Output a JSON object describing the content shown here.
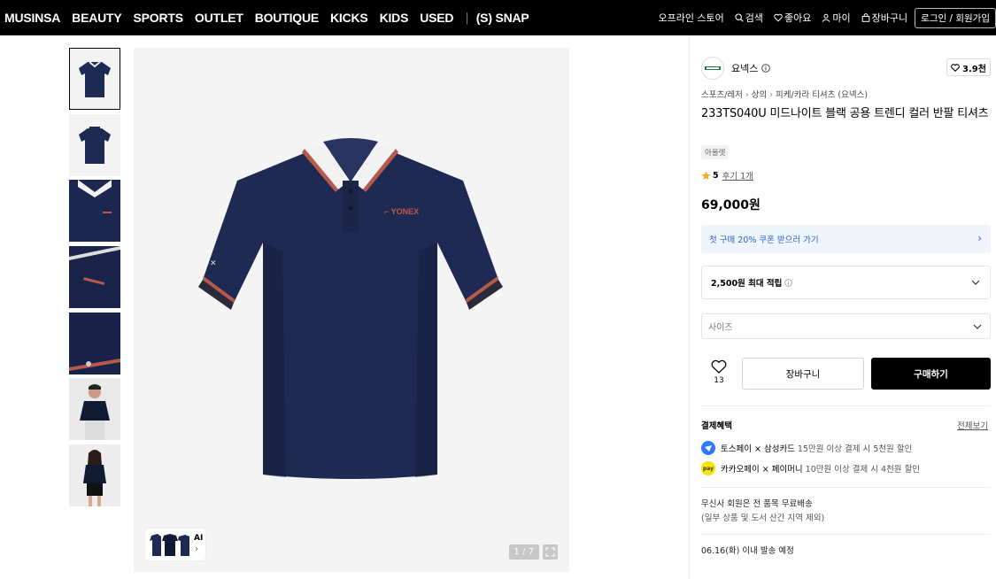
{
  "nav": {
    "items": [
      "MUSINSA",
      "BEAUTY",
      "SPORTS",
      "OUTLET",
      "BOUTIQUE",
      "KICKS",
      "KIDS",
      "USED"
    ],
    "snap": "(S) SNAP",
    "offline_store": "오프라인 스토어",
    "search": "검색",
    "likes": "좋아요",
    "my": "마이",
    "cart": "장바구니",
    "login": "로그인 / 회원가입"
  },
  "gallery": {
    "ai_label": "AI",
    "counter": "1 / 7"
  },
  "product": {
    "brand_name": "요넥스",
    "brand_likes": "3.9천",
    "breadcrumbs": [
      "스포츠/레저",
      "상의",
      "피케/카라 티셔츠 (요넥스)"
    ],
    "title": "233TS040U 미드나이트 블랙 공용 트렌디 컬러 반팔 티셔츠",
    "tag": "아울렛",
    "rating": "5",
    "reviews": "후기 1개",
    "price": "69,000원",
    "coupon": "첫 구매 20% 쿠폰 받으러 가기",
    "points": "2,500원 최대 적립",
    "size_placeholder": "사이즈",
    "like_count": "13",
    "cart_button": "장바구니",
    "buy_button": "구매하기"
  },
  "benefits": {
    "title": "결제혜택",
    "view_all": "전체보기",
    "rows": [
      {
        "name": "토스페이 × 삼성카드",
        "desc": "15만원 이상 결제 시 5천원 할인",
        "icon": "toss-icon",
        "color": "#2f7bf5"
      },
      {
        "name": "카카오페이 × 페이머니",
        "desc": "10만원 이상 결제 시 4천원 할인",
        "icon": "kakaopay-icon",
        "color": "#ffe300"
      }
    ]
  },
  "shipping": {
    "line1": "무신사 회원은 전 품목 무료배송",
    "line2": "(일부 상품 및 도서 산간 지역 제외)",
    "line3": "06.16(화) 이내 발송 예정"
  },
  "colors": {
    "shirt_navy": "#1e2a52",
    "accent_blue": "#2b62d6",
    "collar_stripe": "#b85a4a"
  }
}
